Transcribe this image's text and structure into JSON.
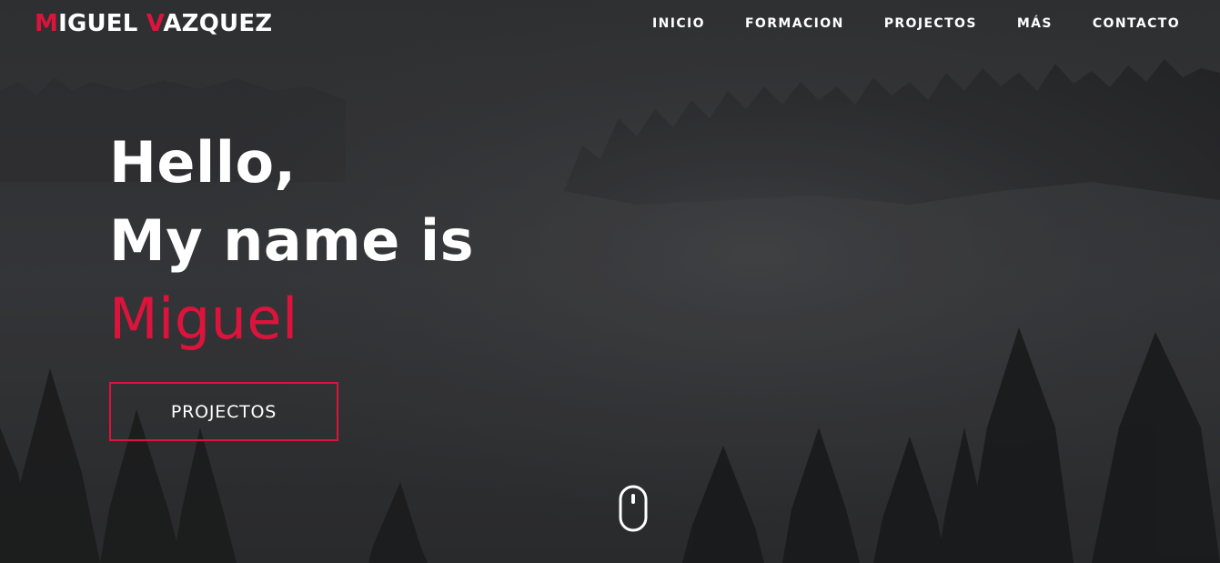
{
  "brand": {
    "first_initial": "M",
    "first_rest": "IGUEL ",
    "last_initial": "V",
    "last_rest": "AZQUEZ"
  },
  "nav": {
    "items": [
      {
        "label": "INICIO"
      },
      {
        "label": "FORMACION"
      },
      {
        "label": "PROJECTOS"
      },
      {
        "label": "MÁS"
      },
      {
        "label": "CONTACTO"
      }
    ]
  },
  "hero": {
    "line1": "Hello,",
    "line2": "My name is",
    "name": "Miguel",
    "cta_label": "PROJECTOS"
  },
  "icons": {
    "scroll": "mouse-scroll-icon"
  },
  "colors": {
    "accent": "#dc143c",
    "text": "#ffffff",
    "background": "#3b3c40"
  }
}
